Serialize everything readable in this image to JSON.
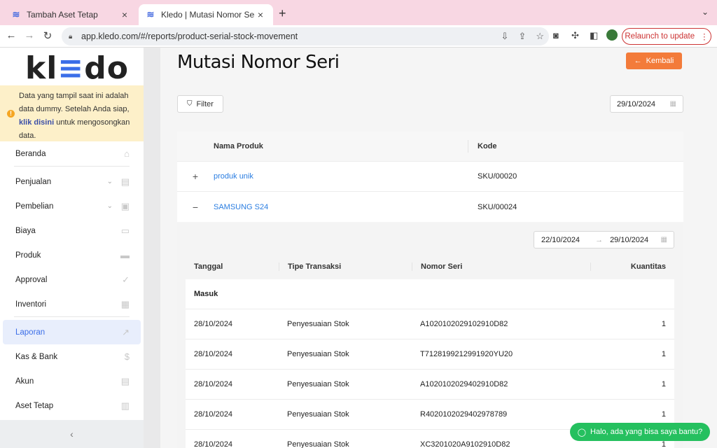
{
  "browser": {
    "tabs": [
      {
        "label": "Tambah Aset Tetap",
        "active": false
      },
      {
        "label": "Kledo | Mutasi Nomor Seri",
        "active": true
      }
    ],
    "url": "app.kledo.com/#/reports/product-serial-stock-movement",
    "relaunch_label": "Relaunch to update"
  },
  "sidebar": {
    "logo": {
      "part1": "kl",
      "part2": "≡",
      "part3": "do"
    },
    "notice": {
      "text_before": "Data yang tampil saat ini adalah data dummy. Setelah Anda siap, ",
      "link": "klik disini",
      "text_after": " untuk mengosongkan data."
    },
    "items": [
      {
        "label": "Beranda",
        "icon": "home-icon",
        "glyph": "⌂"
      },
      {
        "label": "Penjualan",
        "icon": "basket-icon",
        "glyph": "▤"
      },
      {
        "label": "Pembelian",
        "icon": "bag-icon",
        "glyph": "▣"
      },
      {
        "label": "Biaya",
        "icon": "card-icon",
        "glyph": "▭"
      },
      {
        "label": "Produk",
        "icon": "box-icon",
        "glyph": "▬"
      },
      {
        "label": "Approval",
        "icon": "check-icon",
        "glyph": "✓"
      },
      {
        "label": "Inventori",
        "icon": "warehouse-icon",
        "glyph": "▦"
      },
      {
        "label": "Laporan",
        "icon": "chart-icon",
        "glyph": "↗"
      },
      {
        "label": "Kas & Bank",
        "icon": "dollar-icon",
        "glyph": "$"
      },
      {
        "label": "Akun",
        "icon": "book-icon",
        "glyph": "▤"
      },
      {
        "label": "Aset Tetap",
        "icon": "building-icon",
        "glyph": "▥"
      }
    ],
    "active_item": "Laporan"
  },
  "page": {
    "title": "Mutasi Nomor Seri",
    "back_label": "Kembali",
    "filter_label": "Filter",
    "date": "29/10/2024"
  },
  "products_table": {
    "headers": [
      "Nama Produk",
      "Kode"
    ],
    "rows": [
      {
        "toggle": "+",
        "name": "produk unik",
        "code": "SKU/00020"
      },
      {
        "toggle": "−",
        "name": "SAMSUNG S24",
        "code": "SKU/00024"
      }
    ]
  },
  "detail": {
    "range_start": "22/10/2024",
    "range_end": "29/10/2024",
    "headers": [
      "Tanggal",
      "Tipe Transaksi",
      "Nomor Seri",
      "Kuantitas"
    ],
    "group_label": "Masuk",
    "rows": [
      {
        "date": "28/10/2024",
        "type": "Penyesuaian Stok",
        "serial": "A1020102029102910D82",
        "qty": "1"
      },
      {
        "date": "28/10/2024",
        "type": "Penyesuaian Stok",
        "serial": "T7128199212991920YU20",
        "qty": "1"
      },
      {
        "date": "28/10/2024",
        "type": "Penyesuaian Stok",
        "serial": "A1020102029402910D82",
        "qty": "1"
      },
      {
        "date": "28/10/2024",
        "type": "Penyesuaian Stok",
        "serial": "R4020102029402978789",
        "qty": "1"
      },
      {
        "date": "28/10/2024",
        "type": "Penyesuaian Stok",
        "serial": "XC3201020A9102910D82",
        "qty": "1"
      }
    ]
  },
  "chat": {
    "label": "Halo, ada yang bisa saya bantu?"
  },
  "colors": {
    "accent": "#3b6ee8",
    "orange": "#f37b3a",
    "green": "#25c05f",
    "link": "#2a7de1"
  }
}
